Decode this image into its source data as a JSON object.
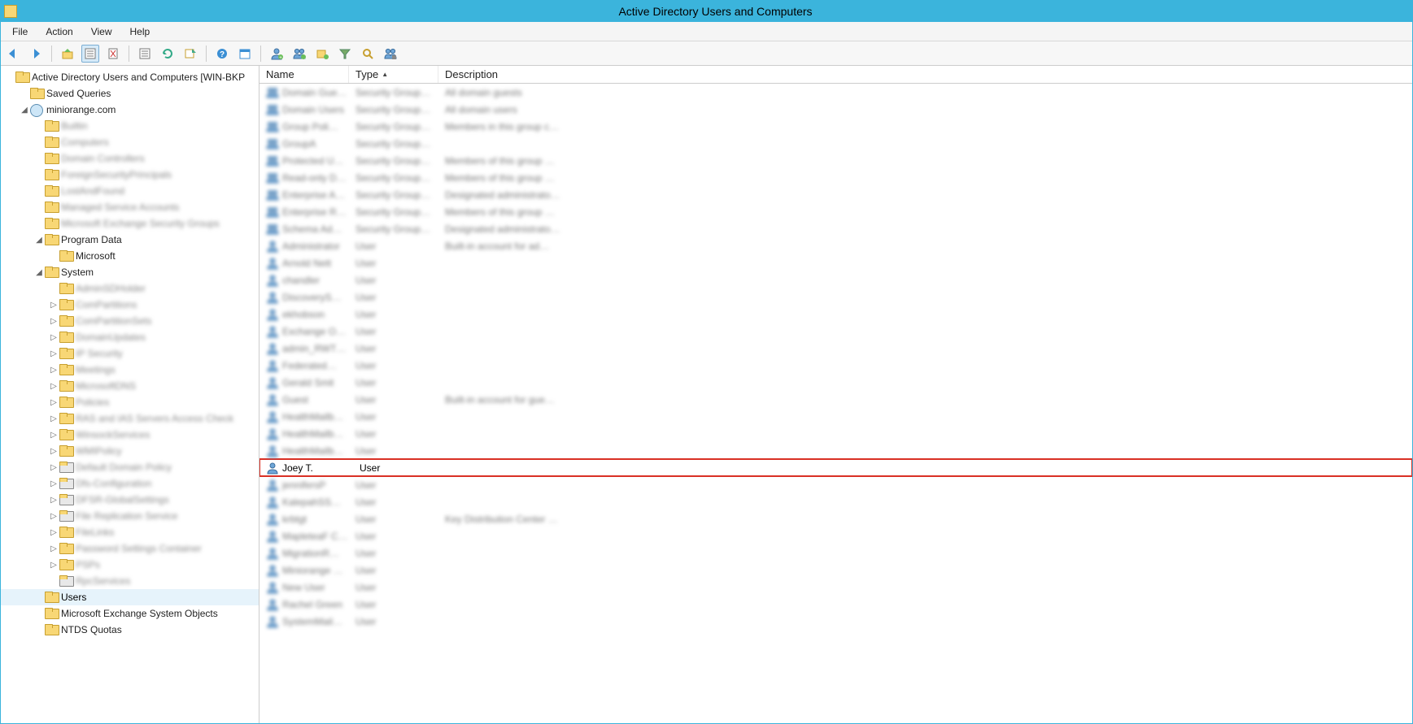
{
  "title": "Active Directory Users and Computers",
  "menu": {
    "file": "File",
    "action": "Action",
    "view": "View",
    "help": "Help"
  },
  "columns": {
    "name": "Name",
    "type": "Type",
    "desc": "Description"
  },
  "tree": {
    "root": "Active Directory Users and Computers [WIN-BKP",
    "saved_queries": "Saved Queries",
    "domain": "miniorange.com",
    "builtin": "Builtin",
    "computers": "Computers",
    "domain_controllers": "Domain Controllers",
    "fsp": "ForeignSecurityPrincipals",
    "lostfound": "LostAndFound",
    "msa": "Managed Service Accounts",
    "exchange_sg": "Microsoft Exchange Security Groups",
    "program_data": "Program Data",
    "microsoft": "Microsoft",
    "system": "System",
    "sys_items": [
      "AdminSDHolder",
      "ComPartitions",
      "ComPartitionSets",
      "DomainUpdates",
      "IP Security",
      "Meetings",
      "MicrosoftDNS",
      "Policies",
      "RAS and IAS Servers Access Check",
      "WinsockServices",
      "WMIPolicy",
      "Default Domain Policy",
      "Dfs-Configuration",
      "DFSR-GlobalSettings",
      "File Replication Service",
      "FileLinks",
      "Password Settings Container",
      "PSPs",
      "RpcServices"
    ],
    "users": "Users",
    "mes_objects": "Microsoft Exchange System Objects",
    "ntds": "NTDS Quotas"
  },
  "list": [
    {
      "icon": "group",
      "name": "Domain Gue…",
      "type": "Security Group…",
      "desc": "All domain guests",
      "blur": true
    },
    {
      "icon": "group",
      "name": "Domain Users",
      "type": "Security Group…",
      "desc": "All domain users",
      "blur": true
    },
    {
      "icon": "group",
      "name": "Group Poli…",
      "type": "Security Group…",
      "desc": "Members in this group c…",
      "blur": true
    },
    {
      "icon": "group",
      "name": "GroupA",
      "type": "Security Group…",
      "desc": "",
      "blur": true
    },
    {
      "icon": "group",
      "name": "Protected U…",
      "type": "Security Group…",
      "desc": "Members of this group …",
      "blur": true
    },
    {
      "icon": "group",
      "name": "Read-only D…",
      "type": "Security Group…",
      "desc": "Members of this group …",
      "blur": true
    },
    {
      "icon": "group",
      "name": "Enterprise A…",
      "type": "Security Group…",
      "desc": "Designated administrato…",
      "blur": true
    },
    {
      "icon": "group",
      "name": "Enterprise R…",
      "type": "Security Group…",
      "desc": "Members of this group …",
      "blur": true
    },
    {
      "icon": "group",
      "name": "Schema Ad…",
      "type": "Security Group…",
      "desc": "Designated administrato…",
      "blur": true
    },
    {
      "icon": "user",
      "name": "Administrator",
      "type": "User",
      "desc": "Built-in account for ad…",
      "blur": true
    },
    {
      "icon": "user",
      "name": "Arnold Nett",
      "type": "User",
      "desc": "",
      "blur": true
    },
    {
      "icon": "user",
      "name": "chandler",
      "type": "User",
      "desc": "",
      "blur": true
    },
    {
      "icon": "user",
      "name": "DiscoveryS…",
      "type": "User",
      "desc": "",
      "blur": true
    },
    {
      "icon": "user",
      "name": "ekhobson",
      "type": "User",
      "desc": "",
      "blur": true
    },
    {
      "icon": "user",
      "name": "Exchange O…",
      "type": "User",
      "desc": "",
      "blur": true
    },
    {
      "icon": "user",
      "name": "admin_RWT…",
      "type": "User",
      "desc": "",
      "blur": true
    },
    {
      "icon": "user",
      "name": "Federated…",
      "type": "User",
      "desc": "",
      "blur": true
    },
    {
      "icon": "user",
      "name": "Gerald Smit",
      "type": "User",
      "desc": "",
      "blur": true
    },
    {
      "icon": "user",
      "name": "Guest",
      "type": "User",
      "desc": "Built-in account for gue…",
      "blur": true
    },
    {
      "icon": "user",
      "name": "HealthMailb…",
      "type": "User",
      "desc": "",
      "blur": true
    },
    {
      "icon": "user",
      "name": "HealthMailb…",
      "type": "User",
      "desc": "",
      "blur": true
    },
    {
      "icon": "user",
      "name": "HealthMailb…",
      "type": "User",
      "desc": "",
      "blur": true
    },
    {
      "icon": "user",
      "name": "Joey T.",
      "type": "User",
      "desc": "",
      "blur": false,
      "highlight": true
    },
    {
      "icon": "user",
      "name": "jennifersP",
      "type": "User",
      "desc": "",
      "blur": true
    },
    {
      "icon": "user",
      "name": "KalepahSS…",
      "type": "User",
      "desc": "",
      "blur": true
    },
    {
      "icon": "user",
      "name": "krbtgt",
      "type": "User",
      "desc": "Key Distribution Center …",
      "blur": true
    },
    {
      "icon": "user",
      "name": "MapleteaF C…",
      "type": "User",
      "desc": "",
      "blur": true
    },
    {
      "icon": "user",
      "name": "MigrationR…",
      "type": "User",
      "desc": "",
      "blur": true
    },
    {
      "icon": "user",
      "name": "Miniorange …",
      "type": "User",
      "desc": "",
      "blur": true
    },
    {
      "icon": "user",
      "name": "New User",
      "type": "User",
      "desc": "",
      "blur": true
    },
    {
      "icon": "user",
      "name": "Rachel Green",
      "type": "User",
      "desc": "",
      "blur": true
    },
    {
      "icon": "user",
      "name": "SystemMail…",
      "type": "User",
      "desc": "",
      "blur": true
    }
  ]
}
